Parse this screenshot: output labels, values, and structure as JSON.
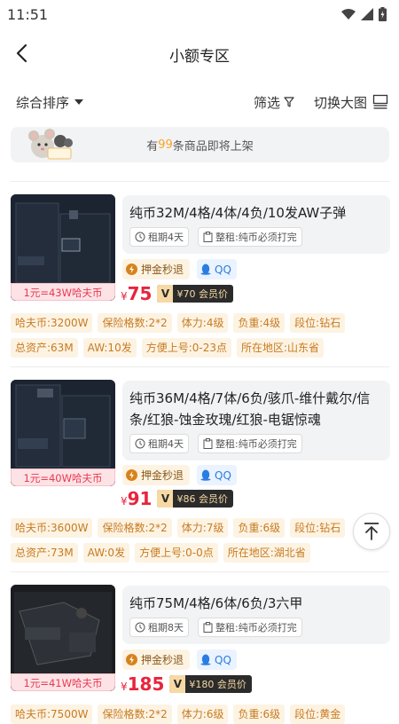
{
  "status": {
    "time": "11:51"
  },
  "header": {
    "title": "小额专区"
  },
  "filters": {
    "sort_label": "综合排序",
    "filter_label": "筛选",
    "switch_label": "切换大图"
  },
  "notice": {
    "prefix": "有",
    "count": "99",
    "suffix": "条商品即将上架"
  },
  "products": [
    {
      "name": "纯币32M/4格/4体/4负/10发AW子弹",
      "rent": "租期4天",
      "condition": "整租:纯币必须打完",
      "refund": "押金秒退",
      "qq": "QQ",
      "price": "75",
      "vip_price": "¥70",
      "vip_label": "会员价",
      "rate": "1元=43W哈夫币",
      "attrs": [
        "哈夫币:3200W",
        "保险格数:2*2",
        "体力:4级",
        "负重:4级",
        "段位:钻石",
        "总资产:63M",
        "AW:10发",
        "方便上号:0-23点",
        "所在地区:山东省"
      ]
    },
    {
      "name": "纯币36M/4格/7体/6负/骇爪-维什戴尔/信条/红狼-蚀金玫瑰/红狼-电锯惊魂",
      "rent": "租期4天",
      "condition": "整租:纯币必须打完",
      "refund": "押金秒退",
      "qq": "QQ",
      "price": "91",
      "vip_price": "¥86",
      "vip_label": "会员价",
      "rate": "1元=40W哈夫币",
      "attrs": [
        "哈夫币:3600W",
        "保险格数:2*2",
        "体力:7级",
        "负重:6级",
        "段位:钻石",
        "总资产:73M",
        "AW:0发",
        "方便上号:0-0点",
        "所在地区:湖北省"
      ]
    },
    {
      "name": "纯币75M/4格/6体/6负/3六甲",
      "rent": "租期8天",
      "condition": "整租:纯币必须打完",
      "refund": "押金秒退",
      "qq": "QQ",
      "price": "185",
      "vip_price": "¥180",
      "vip_label": "会员价",
      "rate": "1元=41W哈夫币",
      "attrs": [
        "哈夫币:7500W",
        "保险格数:2*2",
        "体力:6级",
        "负重:6级",
        "段位:黄金"
      ]
    }
  ]
}
